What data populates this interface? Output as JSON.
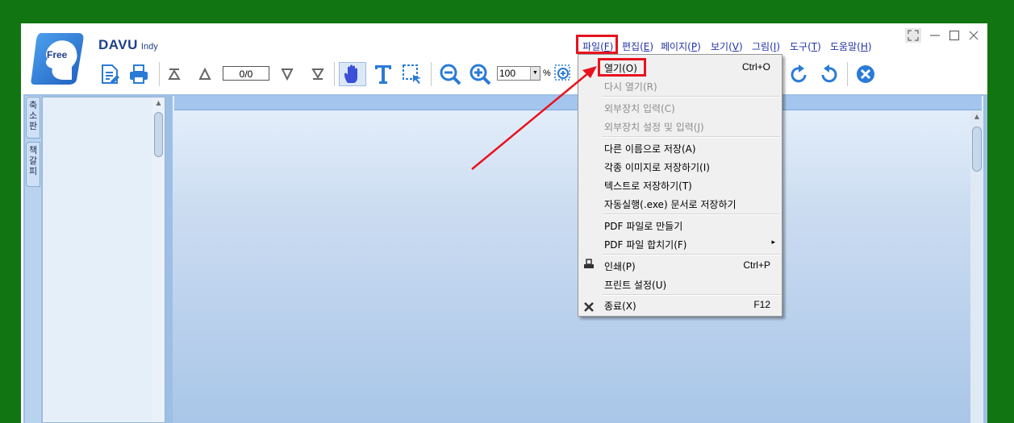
{
  "app": {
    "logo_badge": "Free",
    "brand_name": "DAVU",
    "brand_sub": "Indy"
  },
  "toolbar": {
    "page_indicator": "0/0",
    "zoom_value": "100",
    "zoom_unit": "%",
    "icons": [
      "edit-doc-icon",
      "print-icon",
      "first-page-icon",
      "prev-page-icon",
      "next-page-icon",
      "last-page-icon",
      "hand-tool-icon",
      "text-select-icon",
      "area-select-icon",
      "zoom-out-icon",
      "zoom-in-icon",
      "zoom-area-icon",
      "rotate-right-icon",
      "rotate-left-icon",
      "close-doc-icon"
    ]
  },
  "menubar": [
    {
      "label": "파일(",
      "key": "F",
      "end": ")"
    },
    {
      "label": "편집(",
      "key": "E",
      "end": ")"
    },
    {
      "label": "페이지(",
      "key": "P",
      "end": ")"
    },
    {
      "label": "보기(",
      "key": "V",
      "end": ")"
    },
    {
      "label": "그림(",
      "key": "I",
      "end": ")"
    },
    {
      "label": "도구(",
      "key": "T",
      "end": ")"
    },
    {
      "label": "도움말(",
      "key": "H",
      "end": ")"
    }
  ],
  "sidebar": {
    "tabs": [
      "축소판",
      "책갈피"
    ]
  },
  "file_menu": {
    "items": [
      {
        "label": "열기(O)",
        "shortcut": "Ctrl+O",
        "enabled": true
      },
      {
        "label": "다시 열기(R)",
        "shortcut": "",
        "enabled": false
      },
      {
        "label": "외부장치 입력(C)",
        "shortcut": "",
        "enabled": false
      },
      {
        "label": "외부장치 설정 및 입력(J)",
        "shortcut": "",
        "enabled": false
      },
      {
        "label": "다른 이름으로 저장(A)",
        "shortcut": "",
        "enabled": true
      },
      {
        "label": "각종 이미지로 저장하기(I)",
        "shortcut": "",
        "enabled": true
      },
      {
        "label": "텍스트로 저장하기(T)",
        "shortcut": "",
        "enabled": true
      },
      {
        "label": "자동실행(.exe) 문서로 저장하기",
        "shortcut": "",
        "enabled": true
      },
      {
        "label": "PDF 파일로 만들기",
        "shortcut": "",
        "enabled": true
      },
      {
        "label": "PDF 파일 합치기(F)",
        "shortcut": "▸",
        "enabled": true
      },
      {
        "label": "인쇄(P)",
        "shortcut": "Ctrl+P",
        "enabled": true
      },
      {
        "label": "프린트 설정(U)",
        "shortcut": "",
        "enabled": true
      },
      {
        "label": "종료(X)",
        "shortcut": "F12",
        "enabled": true
      }
    ]
  },
  "colors": {
    "desktop": "#117511",
    "highlight": "#e8121e",
    "accent": "#2a7bd6"
  }
}
